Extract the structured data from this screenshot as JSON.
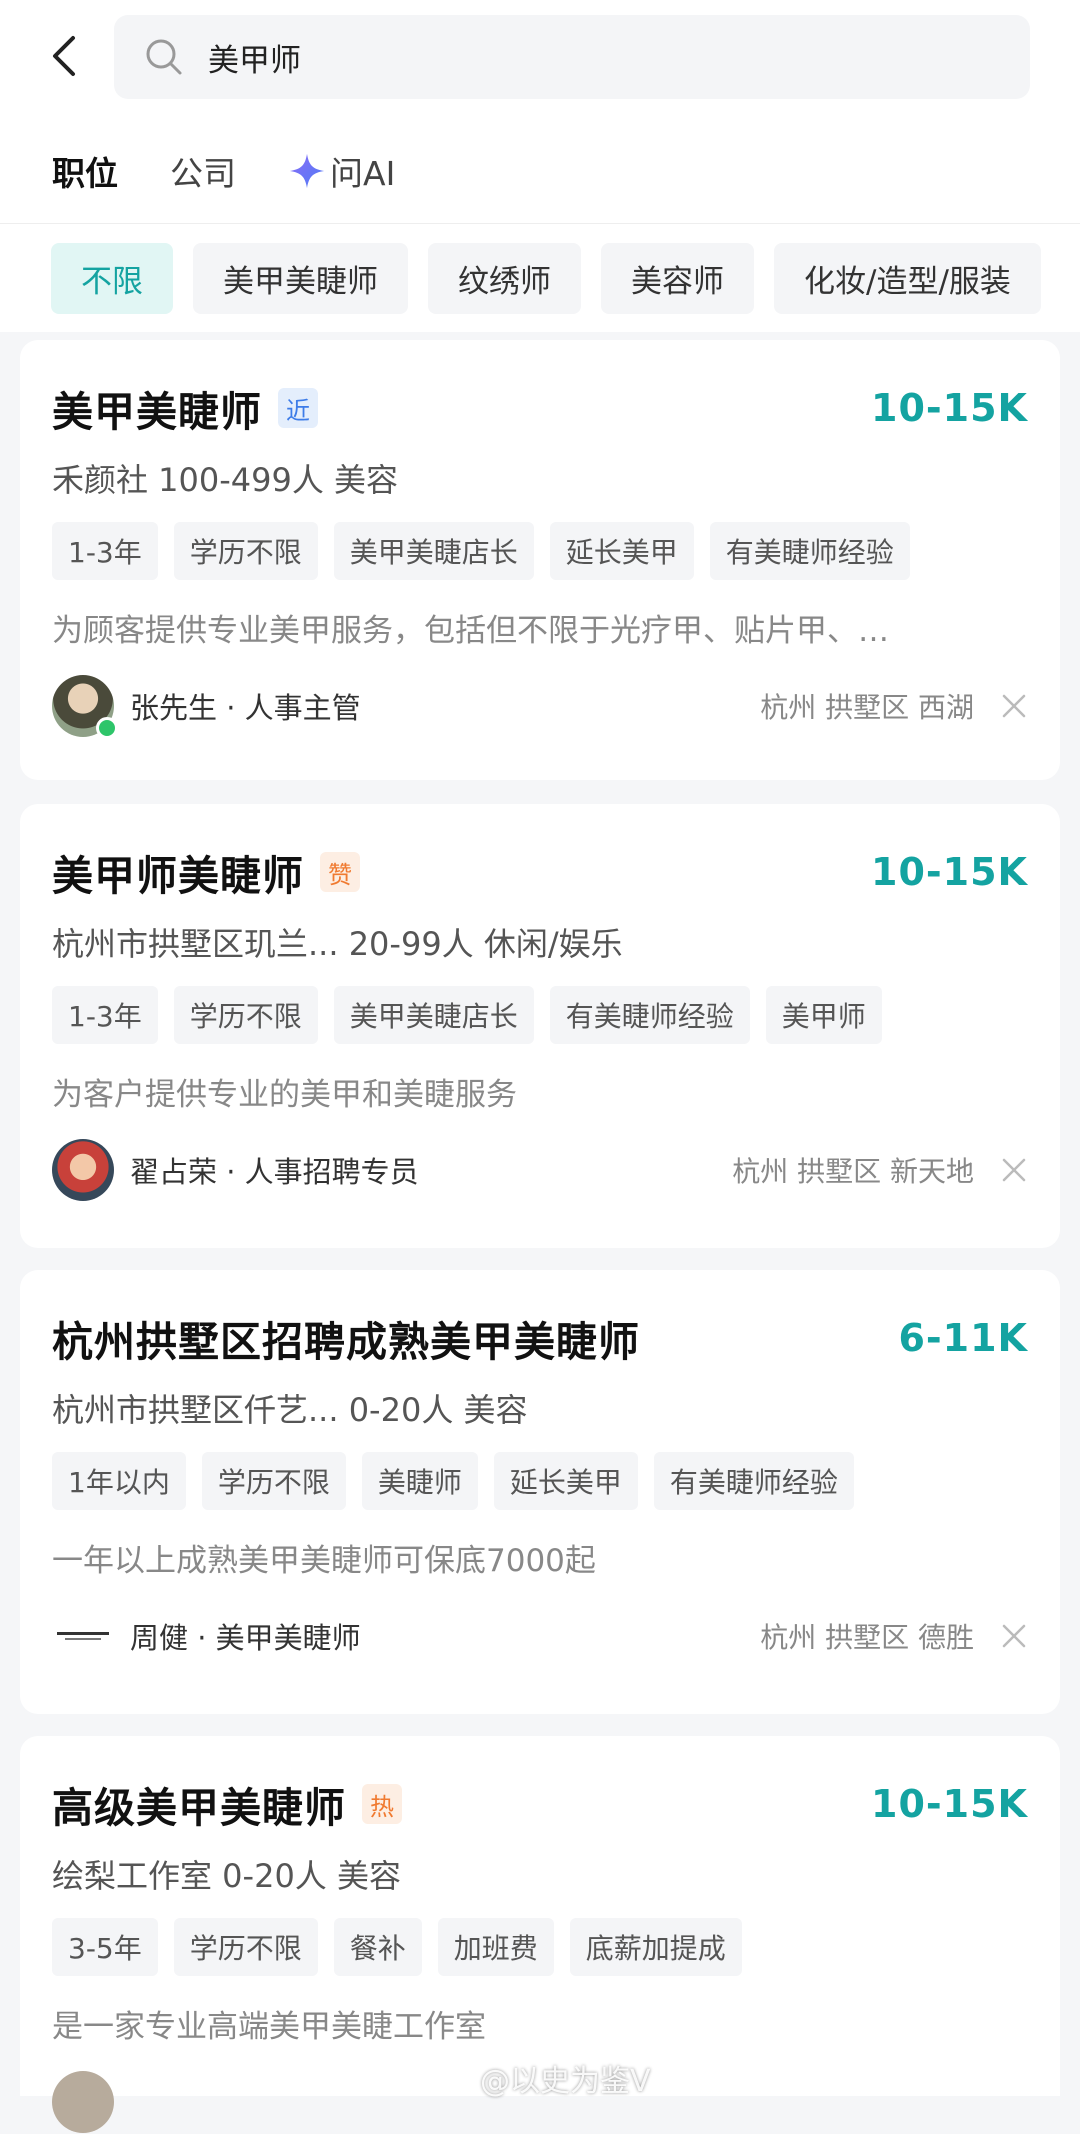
{
  "search": {
    "value": "美甲师"
  },
  "tabs": [
    {
      "label": "职位"
    },
    {
      "label": "公司"
    },
    {
      "label": "问AI"
    }
  ],
  "filters": [
    {
      "label": "不限"
    },
    {
      "label": "美甲美睫师"
    },
    {
      "label": "纹绣师"
    },
    {
      "label": "美容师"
    },
    {
      "label": "化妆/造型/服装"
    }
  ],
  "jobs": [
    {
      "title": "美甲美睫师",
      "badge": "近",
      "salary": "10-15K",
      "company": "禾颜社 100-499人 美容",
      "tags": [
        "1-3年",
        "学历不限",
        "美甲美睫店长",
        "延长美甲",
        "有美睫师经验"
      ],
      "description": "为顾客提供专业美甲服务，包括但不限于光疗甲、贴片甲、…",
      "recruiter": "张先生 · 人事主管",
      "location": "杭州 拱墅区 西湖"
    },
    {
      "title": "美甲师美睫师",
      "badge": "赞",
      "salary": "10-15K",
      "company": "杭州市拱墅区玑兰... 20-99人 休闲/娱乐",
      "tags": [
        "1-3年",
        "学历不限",
        "美甲美睫店长",
        "有美睫师经验",
        "美甲师"
      ],
      "description": "为客户提供专业的美甲和美睫服务",
      "recruiter": "翟占荣 · 人事招聘专员",
      "location": "杭州 拱墅区 新天地"
    },
    {
      "title": "杭州拱墅区招聘成熟美甲美睫师",
      "salary": "6-11K",
      "company": "杭州市拱墅区仟艺... 0-20人 美容",
      "tags": [
        "1年以内",
        "学历不限",
        "美睫师",
        "延长美甲",
        "有美睫师经验"
      ],
      "description": "一年以上成熟美甲美睫师可保底7000起",
      "recruiter": "周健 · 美甲美睫师",
      "location": "杭州 拱墅区 德胜"
    },
    {
      "title": "高级美甲美睫师",
      "badge": "热",
      "salary": "10-15K",
      "company": "绘梨工作室 0-20人 美容",
      "tags": [
        "3-5年",
        "学历不限",
        "餐补",
        "加班费",
        "底薪加提成"
      ],
      "description": "是一家专业高端美甲美睫工作室"
    }
  ],
  "watermark": "@以史为鉴V",
  "colors": {
    "accent": "#14a3a1",
    "chip_selected_bg": "#e1f6f4",
    "ai_star": "#6a6df5"
  }
}
